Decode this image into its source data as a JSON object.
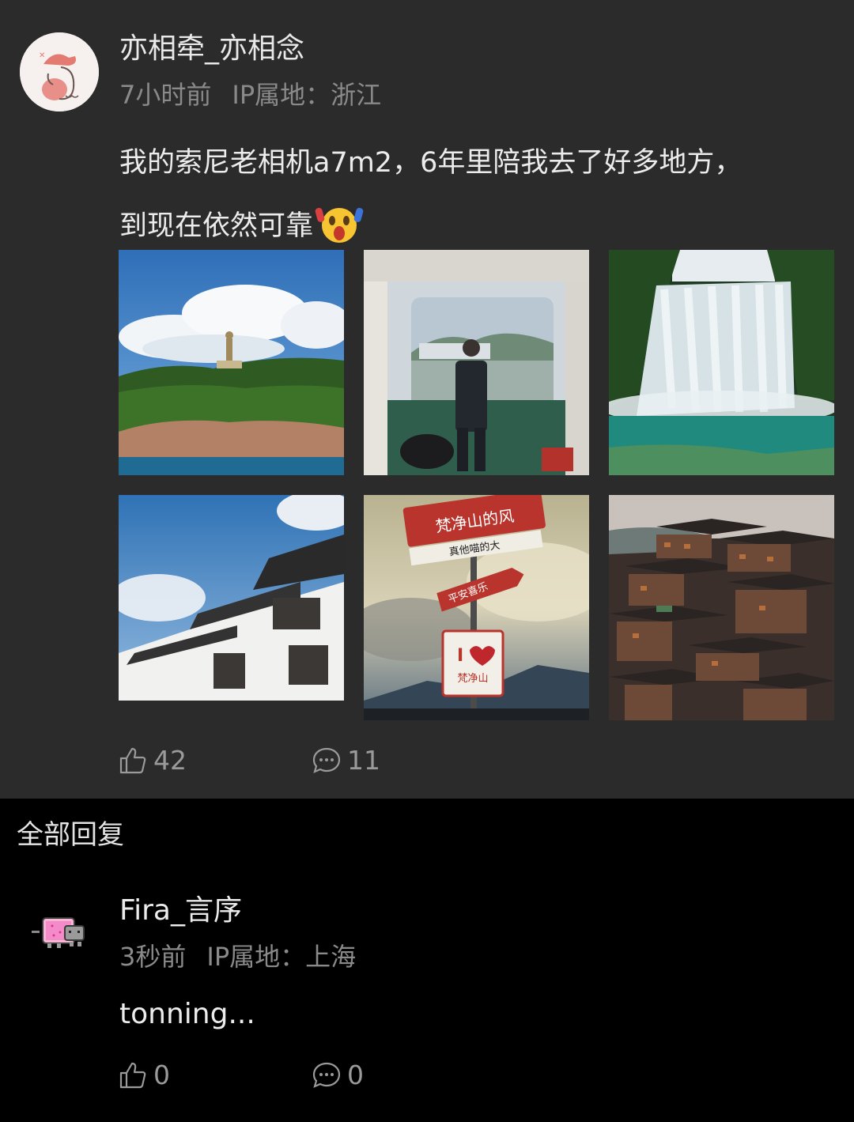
{
  "post": {
    "author": "亦相牵_亦相念",
    "time": "7小时前",
    "ip": "IP属地：浙江",
    "text_line1": "我的索尼老相机a7m2，6年里陪我去了好多地方，",
    "text_line2": "到现在依然可靠",
    "emoji": "shocked-face-emoji",
    "photos": [
      {
        "name": "photo-statue-island",
        "sign": []
      },
      {
        "name": "photo-ferry-man",
        "sign": []
      },
      {
        "name": "photo-waterfall",
        "sign": []
      },
      {
        "name": "photo-white-buildings",
        "sign": []
      },
      {
        "name": "photo-fanjingshan-sign",
        "sign": [
          "梵净山的风",
          "真他喵的大",
          "平安喜乐",
          "I",
          "梵净山"
        ]
      },
      {
        "name": "photo-stilt-village",
        "sign": []
      }
    ],
    "likes": "42",
    "comments": "11"
  },
  "replies": {
    "heading": "全部回复",
    "items": [
      {
        "author": "Fira_言序",
        "time": "3秒前",
        "ip": "IP属地：上海",
        "text": "tonning...",
        "likes": "0",
        "comments": "0"
      }
    ]
  },
  "colors": {
    "post_bg": "#2b2b2b",
    "page_bg": "#000000",
    "primary_text": "#ececec",
    "secondary_text": "#8a8a8a"
  }
}
